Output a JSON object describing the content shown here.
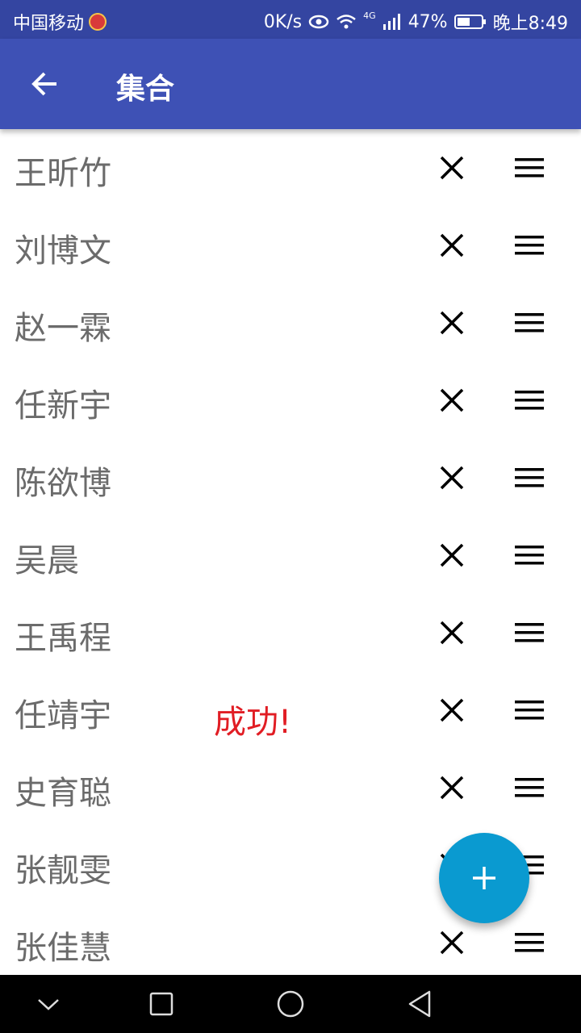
{
  "status_bar": {
    "carrier": "中国移动",
    "network_speed": "0K/s",
    "signal_type": "4G",
    "battery": "47%",
    "time": "晚上8:49"
  },
  "app_bar": {
    "title": "集合"
  },
  "list": {
    "items": [
      {
        "name": "王昕竹"
      },
      {
        "name": "刘博文"
      },
      {
        "name": "赵一霖"
      },
      {
        "name": "任新宇"
      },
      {
        "name": "陈欲博"
      },
      {
        "name": "吴晨"
      },
      {
        "name": "王禹程"
      },
      {
        "name": "任靖宇"
      },
      {
        "name": "史育聪"
      },
      {
        "name": "张靓雯"
      },
      {
        "name": "张佳慧"
      }
    ]
  },
  "toast": {
    "message": "成功!",
    "color": "#e11d24"
  },
  "colors": {
    "status_bar": "#3445a1",
    "app_bar": "#3e51b5",
    "fab": "#0a9ad0"
  },
  "icons": {
    "back": "arrow-back-icon",
    "delete": "close-icon",
    "drag": "drag-handle-icon",
    "add": "plus-icon",
    "nav_collapse": "chevron-down-icon",
    "nav_recents": "square-icon",
    "nav_home": "circle-icon",
    "nav_back": "triangle-back-icon"
  }
}
